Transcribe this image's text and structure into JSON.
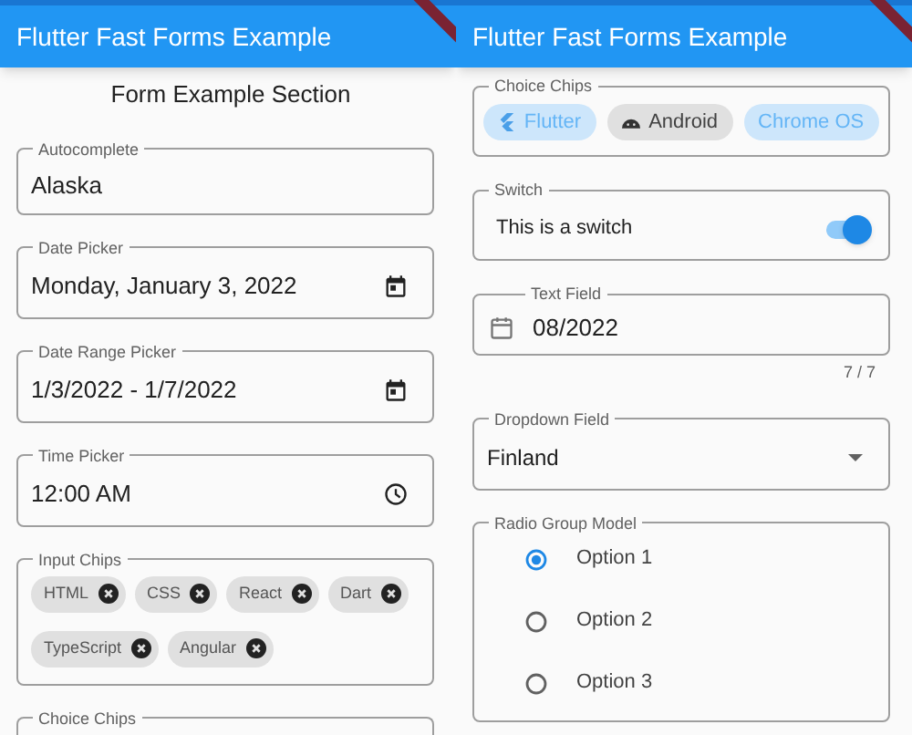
{
  "screens": [
    {
      "app_bar": {
        "title": "Flutter Fast Forms Example"
      },
      "section_title": "Form Example Section",
      "fields": [
        {
          "kind": "text",
          "label": "Autocomplete",
          "value": "Alaska"
        },
        {
          "kind": "date",
          "label": "Date Picker",
          "value": "Monday, January 3, 2022"
        },
        {
          "kind": "date",
          "label": "Date Range Picker",
          "value": "1/3/2022 - 1/7/2022"
        },
        {
          "kind": "time",
          "label": "Time Picker",
          "value": "12:00 AM"
        },
        {
          "kind": "input_chips",
          "label": "Input Chips",
          "chips": [
            "HTML",
            "CSS",
            "React",
            "Dart",
            "TypeScript",
            "Angular"
          ]
        },
        {
          "kind": "cut",
          "label": "Choice Chips"
        }
      ]
    },
    {
      "app_bar": {
        "title": "Flutter Fast Forms Example"
      },
      "fields": [
        {
          "kind": "choice_chips",
          "label": "Choice Chips",
          "chips": [
            {
              "label": "Flutter",
              "selected": true
            },
            {
              "label": "Android",
              "selected": false
            },
            {
              "label": "Chrome OS",
              "selected": true
            }
          ]
        },
        {
          "kind": "switch",
          "label": "Switch",
          "text": "This is a switch",
          "on": true
        },
        {
          "kind": "prefixed",
          "label": "Text Field",
          "value": "08/2022",
          "counter": "7 / 7"
        },
        {
          "kind": "dropdown",
          "label": "Dropdown Field",
          "value": "Finland"
        },
        {
          "kind": "radio",
          "label": "Radio Group Model",
          "options": [
            {
              "label": "Option 1",
              "selected": true
            },
            {
              "label": "Option 2",
              "selected": false
            },
            {
              "label": "Option 3",
              "selected": false
            }
          ]
        }
      ]
    }
  ]
}
